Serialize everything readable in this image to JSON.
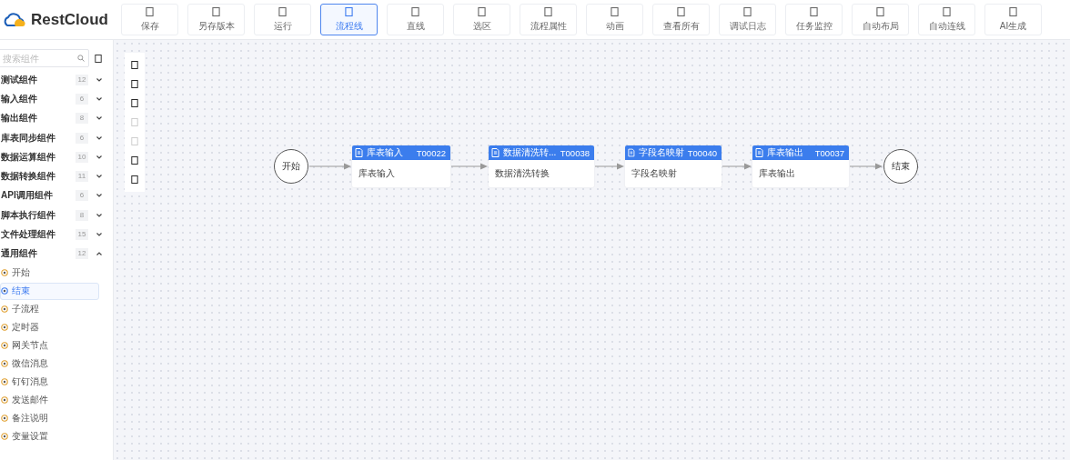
{
  "header": {
    "logo": "RestCloud",
    "tools": [
      {
        "label": "保存",
        "selected": false
      },
      {
        "label": "另存版本",
        "selected": false
      },
      {
        "label": "运行",
        "selected": false
      },
      {
        "label": "流程线",
        "selected": true
      },
      {
        "label": "直线",
        "selected": false
      },
      {
        "label": "选区",
        "selected": false
      },
      {
        "label": "流程属性",
        "selected": false
      },
      {
        "label": "动画",
        "selected": false
      },
      {
        "label": "查看所有",
        "selected": false
      },
      {
        "label": "调试日志",
        "selected": false
      },
      {
        "label": "任务监控",
        "selected": false
      },
      {
        "label": "自动布局",
        "selected": false
      },
      {
        "label": "自动连线",
        "selected": false
      },
      {
        "label": "AI生成",
        "selected": false
      }
    ]
  },
  "sidebar": {
    "search": {
      "placeholder": "搜索组件"
    },
    "groups": [
      {
        "label": "测试组件",
        "count": "12",
        "expanded": false
      },
      {
        "label": "输入组件",
        "count": "6",
        "expanded": false
      },
      {
        "label": "输出组件",
        "count": "8",
        "expanded": false
      },
      {
        "label": "库表同步组件",
        "count": "6",
        "expanded": false
      },
      {
        "label": "数据运算组件",
        "count": "10",
        "expanded": false
      },
      {
        "label": "数据转换组件",
        "count": "11",
        "expanded": false
      },
      {
        "label": "API调用组件",
        "count": "6",
        "expanded": false
      },
      {
        "label": "脚本执行组件",
        "count": "8",
        "expanded": false
      },
      {
        "label": "文件处理组件",
        "count": "15",
        "expanded": false
      },
      {
        "label": "通用组件",
        "count": "12",
        "expanded": true,
        "items": [
          {
            "label": "开始",
            "selected": false
          },
          {
            "label": "结束",
            "selected": true
          },
          {
            "label": "子流程",
            "selected": false
          },
          {
            "label": "定时器",
            "selected": false
          },
          {
            "label": "网关节点",
            "selected": false
          },
          {
            "label": "微信消息",
            "selected": false
          },
          {
            "label": "钉钉消息",
            "selected": false
          },
          {
            "label": "发送邮件",
            "selected": false
          },
          {
            "label": "备注说明",
            "selected": false
          },
          {
            "label": "变量设置",
            "selected": false
          }
        ]
      }
    ]
  },
  "canvas": {
    "tool_panel": [
      {
        "disabled": false
      },
      {
        "disabled": false
      },
      {
        "disabled": false
      },
      {
        "disabled": true
      },
      {
        "disabled": true
      },
      {
        "disabled": false
      },
      {
        "disabled": false
      }
    ],
    "nodes": [
      {
        "kind": "start",
        "label": "开始"
      },
      {
        "kind": "task",
        "title": "库表输入",
        "code": "T00022",
        "body": "库表输入"
      },
      {
        "kind": "task",
        "title": "数据清洗转...",
        "code": "T00038",
        "body": "数据清洗转换"
      },
      {
        "kind": "task",
        "title": "字段名映射",
        "code": "T00040",
        "body": "字段名映射"
      },
      {
        "kind": "task",
        "title": "库表输出",
        "code": "T00037",
        "body": "库表输出"
      },
      {
        "kind": "end",
        "label": "结束"
      }
    ]
  }
}
